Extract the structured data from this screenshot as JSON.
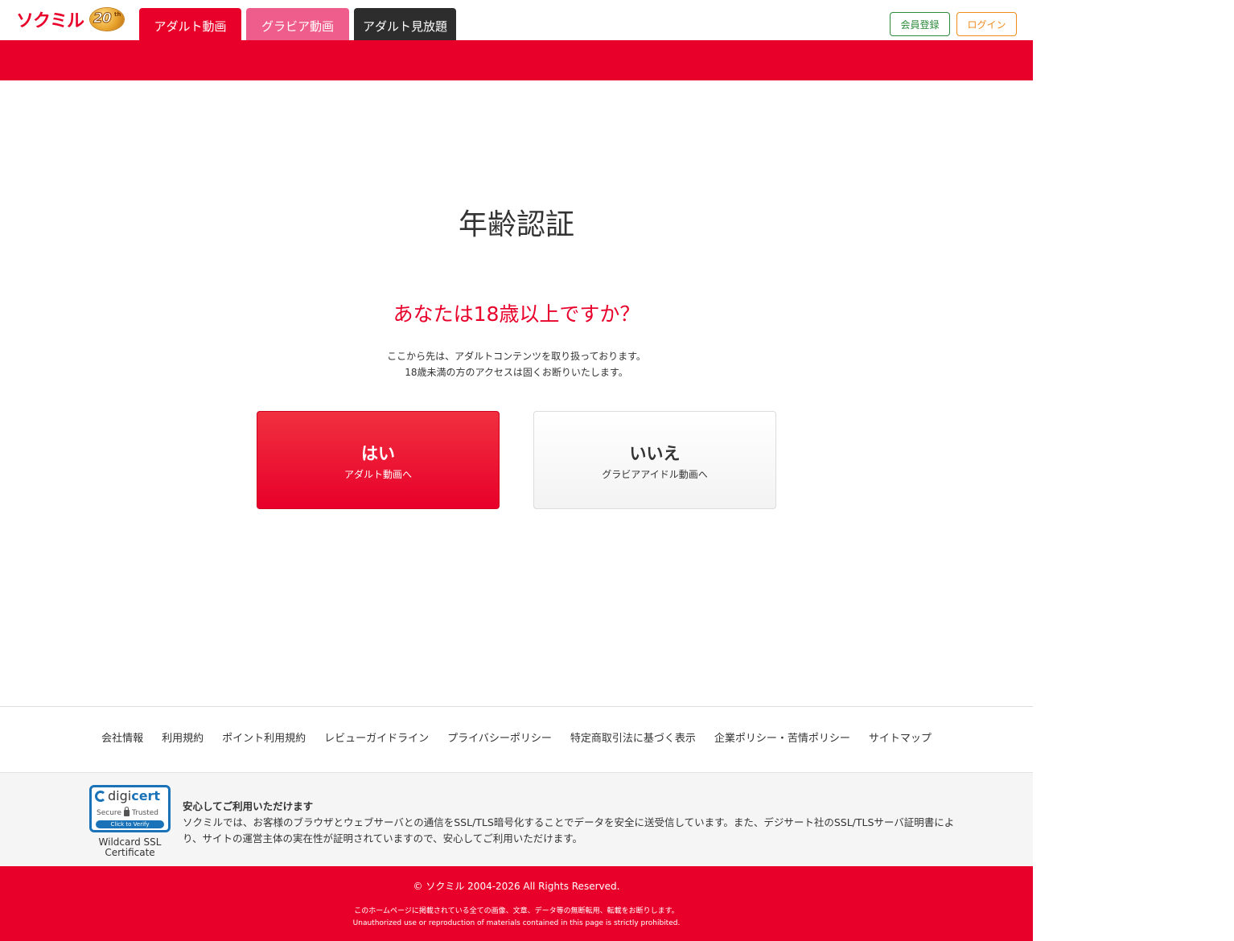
{
  "header": {
    "logo_text": "ソクミル",
    "logo_badge": "20",
    "logo_badge_sup": "th",
    "tabs": [
      {
        "label": "アダルト動画"
      },
      {
        "label": "グラビア動画"
      },
      {
        "label": "アダルト見放題"
      }
    ],
    "register_label": "会員登録",
    "login_label": "ログイン"
  },
  "main": {
    "title": "年齢認証",
    "question": "あなたは18歳以上ですか？",
    "notice_line1": "ここから先は、アダルトコンテンツを取り扱っております。",
    "notice_line2": "18歳未満の方のアクセスは固くお断りいたします。",
    "yes": {
      "label": "はい",
      "sub": "アダルト動画へ"
    },
    "no": {
      "label": "いいえ",
      "sub": "グラビアアイドル動画へ"
    }
  },
  "footer": {
    "links": [
      {
        "label": "会社情報"
      },
      {
        "label": "利用規約"
      },
      {
        "label": "ポイント利用規約"
      },
      {
        "label": "レビューガイドライン"
      },
      {
        "label": "プライバシーポリシー"
      },
      {
        "label": "特定商取引法に基づく表示"
      },
      {
        "label": "企業ポリシー・苦情ポリシー"
      },
      {
        "label": "サイトマップ"
      }
    ],
    "ssl_badge": {
      "brand_digi": "digi",
      "brand_cert": "cert",
      "secure": "Secure",
      "trusted": "Trusted",
      "verify": "Click to Verify",
      "caption_line1": "Wildcard SSL",
      "caption_line2": "Certificate"
    },
    "ssl_heading": "安心してご利用いただけます",
    "ssl_body": "ソクミルでは、お客様のブラウザとウェブサーバとの通信をSSL/TLS暗号化することでデータを安全に送受信しています。また、デジサート社のSSL/TLSサーバ証明書により、サイトの運営主体の実在性が証明されていますので、安心してご利用いただけます。",
    "copyright": "© ソクミル 2004-2026 All Rights Reserved.",
    "notice_jp": "このホームページに掲載されている全ての画像、文章、データ等の無断転用、転載をお断りします。",
    "notice_en": "Unauthorized use or reproduction of materials contained in this page is strictly prohibited."
  },
  "colors": {
    "brand_red": "#e8002a",
    "gravure_pink": "#ef5d8c",
    "unlimited_dark": "#2d2d2d",
    "register_green": "#2c8a3b",
    "login_orange": "#ef8b1b",
    "digicert_blue": "#1a73b8"
  },
  "icons": {
    "logo": "sokmil-logo",
    "badge": "20th-anniversary-badge",
    "ssl": "digicert-lock-icon"
  }
}
